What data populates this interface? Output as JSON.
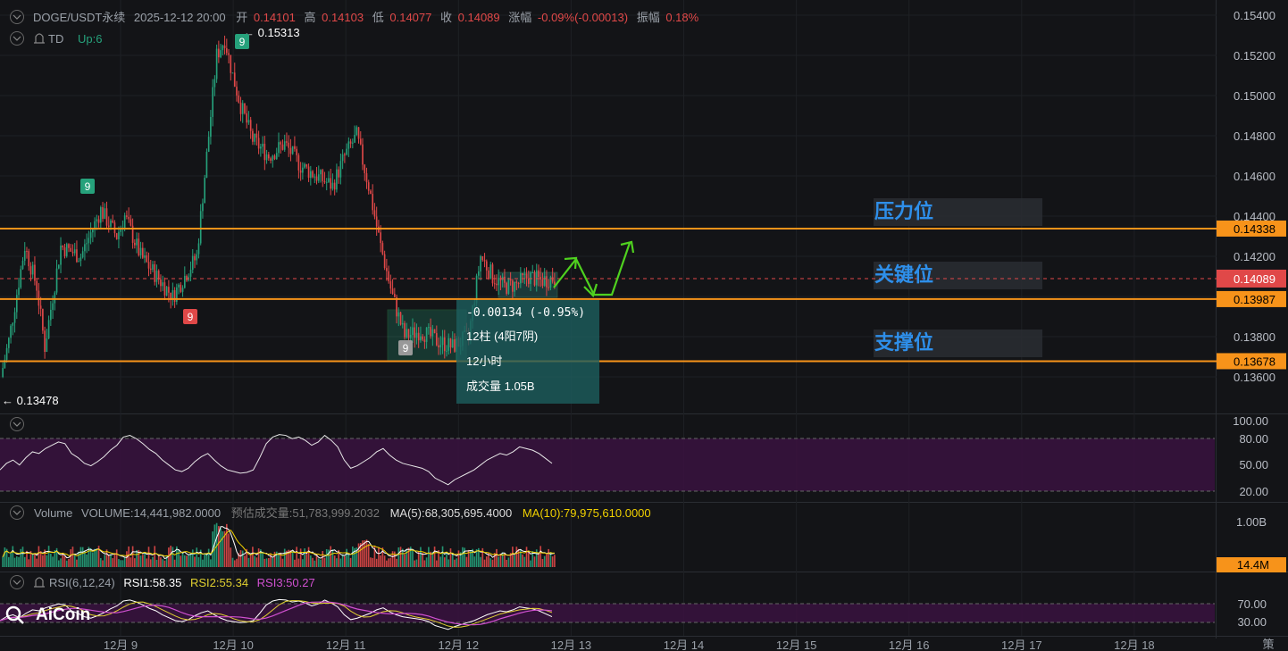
{
  "header": {
    "symbol": "DOGE/USDT永续",
    "datetime": "2025-12-12 20:00",
    "open_label": "开",
    "open": "0.14101",
    "high_label": "高",
    "high": "0.14103",
    "low_label": "低",
    "low": "0.14077",
    "close_label": "收",
    "close": "0.14089",
    "change_label": "涨幅",
    "change": "-0.09%(-0.00013)",
    "amp_label": "振幅",
    "amp": "0.18%",
    "td_label": "TD",
    "td_value": "Up:6"
  },
  "colors": {
    "background": "#131417",
    "up": "#26a17b",
    "down": "#e04848",
    "level": "#f7931a",
    "arrow": "#4fd11f",
    "label_blue": "#2e8fea",
    "rsi_band": "#3a1240",
    "ma10": "#f0d000",
    "ma5": "#ffffff",
    "rsi2": "#e0d030",
    "rsi3": "#d050d0"
  },
  "chart_data": {
    "type": "candlestick",
    "x_ticks": [
      "12月 9",
      "12月 10",
      "12月 11",
      "12月 12",
      "12月 13",
      "12月 14",
      "12月 15",
      "12月 16",
      "12月 17",
      "12月 18"
    ],
    "y_ticks": [
      "0.15400",
      "0.15200",
      "0.15000",
      "0.14800",
      "0.14600",
      "0.14400",
      "0.14200",
      "0.14000",
      "0.13800",
      "0.13600"
    ],
    "ylim": [
      0.1356,
      0.1542
    ],
    "levels": [
      {
        "value": 0.14338,
        "label": "0.14338"
      },
      {
        "value": 0.13987,
        "label": "0.13987"
      },
      {
        "value": 0.13678,
        "label": "0.13678"
      }
    ],
    "current_price": {
      "value": 0.14089,
      "label": "0.14089"
    },
    "annotations": {
      "resistance": "压力位",
      "key": "关键位",
      "support": "支撑位",
      "high_marker": "0.15313",
      "low_marker": "0.13478",
      "td_marks": [
        "9",
        "9",
        "9",
        "9"
      ]
    },
    "measure_box": {
      "change": "-0.00134 (-0.95%)",
      "bars": "12柱 (4阳7阴)",
      "duration": "12小时",
      "volume": "成交量 1.05B"
    },
    "rsi_top": {
      "y_ticks": [
        "100.00",
        "80.00",
        "50.00",
        "20.00"
      ],
      "values": [
        40,
        48,
        52,
        46,
        55,
        62,
        60,
        66,
        70,
        74,
        72,
        60,
        55,
        48,
        45,
        50,
        56,
        64,
        70,
        80,
        82,
        78,
        72,
        65,
        60,
        52,
        46,
        40,
        38,
        42,
        50,
        56,
        60,
        52,
        45,
        40,
        38,
        36,
        37,
        40,
        55,
        72,
        80,
        83,
        82,
        78,
        80,
        76,
        70,
        74,
        82,
        76,
        68,
        52,
        42,
        45,
        50,
        55,
        62,
        66,
        58,
        52,
        48,
        46,
        44,
        42,
        38,
        30,
        26,
        22,
        28,
        32,
        36,
        40,
        46,
        52,
        56,
        60,
        58,
        62,
        68,
        66,
        64,
        60,
        54,
        48
      ],
      "ylim": [
        0,
        100
      ]
    },
    "volume": {
      "label": "Volume",
      "volume_value": "VOLUME:14,441,982.0000",
      "predict": "预估成交量:51,783,999.2032",
      "ma5": "MA(5):68,305,695.4000",
      "ma10": "MA(10):79,975,610.0000",
      "y_tick": "1.00B",
      "current_label": "14.4M"
    },
    "rsi_bottom": {
      "label": "RSI(6,12,24)",
      "rsi1": "RSI1:58.35",
      "rsi2": "RSI2:55.34",
      "rsi3": "RSI3:50.27",
      "y_ticks": [
        "70.00",
        "30.00"
      ]
    }
  },
  "corner_label": "策",
  "logo": "AiCoin"
}
